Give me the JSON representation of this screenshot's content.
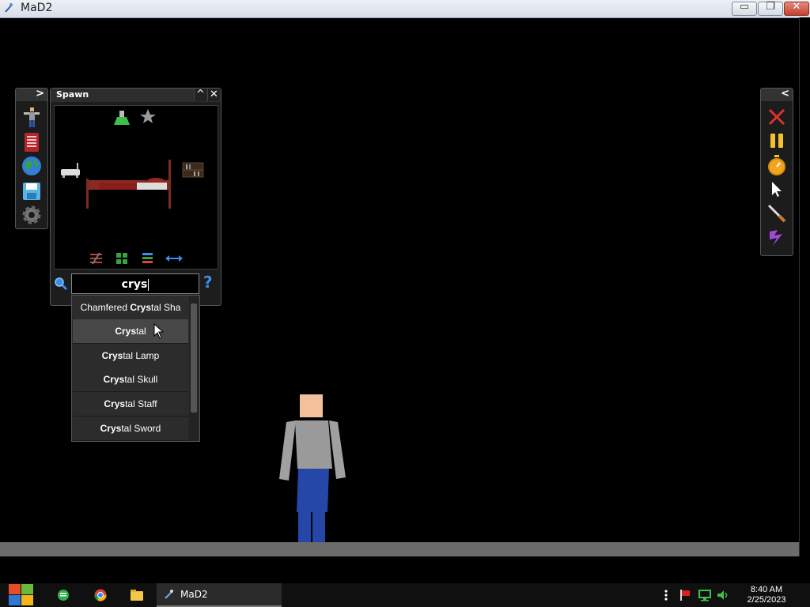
{
  "window": {
    "title": "MaD2",
    "minimize": "▭",
    "restore": "❐",
    "close": "✕"
  },
  "spawn_panel": {
    "title": "Spawn",
    "collapse_glyph": "^",
    "close_glyph": "✕",
    "search": {
      "value": "crys",
      "help_glyph": "?"
    }
  },
  "left_toolbar": {
    "toggle_glyph": ">",
    "icons": [
      "ragdoll-icon",
      "book-icon",
      "globe-icon",
      "save-icon",
      "settings-gear-icon"
    ]
  },
  "right_toolbar": {
    "toggle_glyph": "<",
    "icons": [
      "clear-x-icon",
      "pause-icon",
      "stopwatch-icon",
      "pointer-icon",
      "knife-icon",
      "lightning-icon"
    ]
  },
  "search_results": [
    {
      "pre": "Chamfered ",
      "match": "Crys",
      "post": "tal Sha"
    },
    {
      "pre": "",
      "match": "Crys",
      "post": "tal"
    },
    {
      "pre": "",
      "match": "Crys",
      "post": "tal Lamp"
    },
    {
      "pre": "",
      "match": "Crys",
      "post": "tal Skull"
    },
    {
      "pre": "",
      "match": "Crys",
      "post": "tal Staff"
    },
    {
      "pre": "",
      "match": "Crys",
      "post": "tal Sword"
    }
  ],
  "taskbar": {
    "app_label": "MaD2",
    "time": "8:40 AM",
    "date": "2/25/2023"
  },
  "colors": {
    "background": "#000000",
    "panel": "#1d1d1d",
    "accent_blue": "#3a8ee6"
  }
}
